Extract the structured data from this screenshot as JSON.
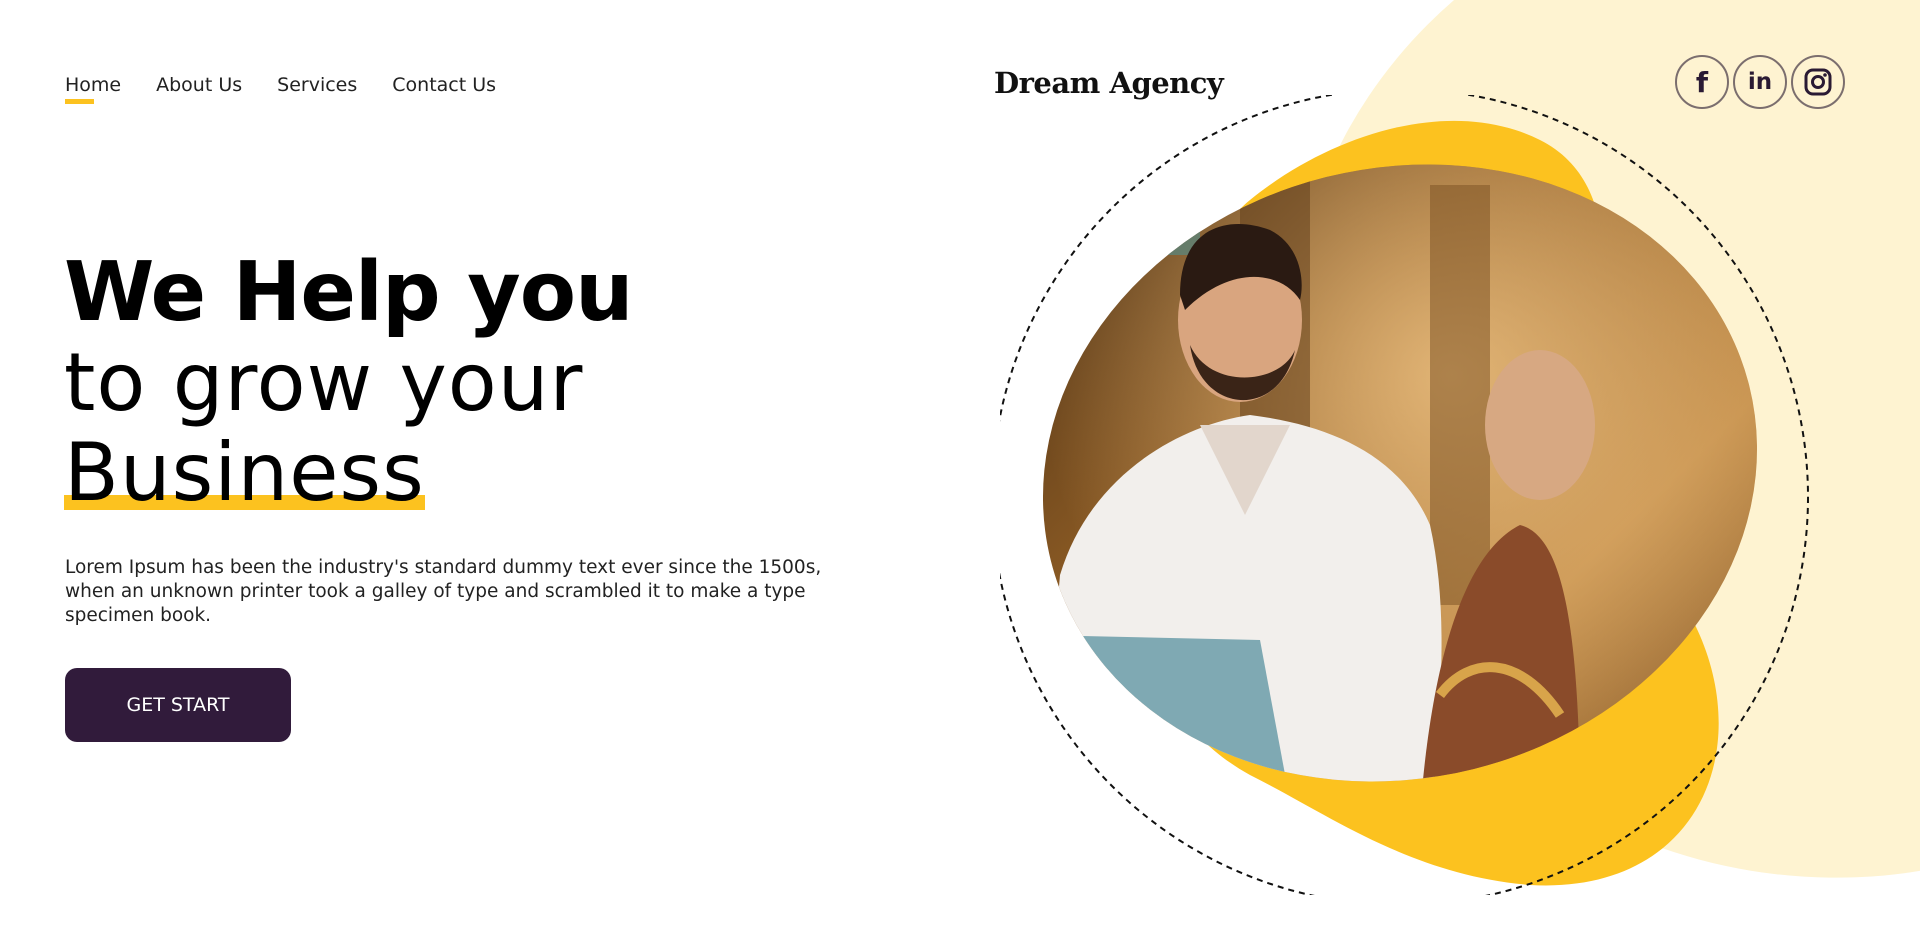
{
  "nav": {
    "items": [
      {
        "label": "Home",
        "active": true
      },
      {
        "label": "About Us",
        "active": false
      },
      {
        "label": "Services",
        "active": false
      },
      {
        "label": "Contact Us",
        "active": false
      }
    ]
  },
  "brand": {
    "name": "Dream Agency"
  },
  "social": {
    "facebook": {
      "icon": "facebook-icon",
      "glyph": "f"
    },
    "linkedin": {
      "icon": "linkedin-icon",
      "glyph": "in"
    },
    "instagram": {
      "icon": "instagram-icon"
    }
  },
  "hero": {
    "title_line1": "We Help you",
    "title_line2": "to grow your",
    "title_line3": "Business",
    "description": "Lorem Ipsum has been the industry's standard dummy text ever since the 1500s, when an unknown printer took a galley of type and scrambled it to make a type specimen book.",
    "cta_label": "GET START"
  },
  "colors": {
    "accent": "#fcc21f",
    "cream": "#fef3d1",
    "button": "#311b3b",
    "text": "#000000"
  }
}
